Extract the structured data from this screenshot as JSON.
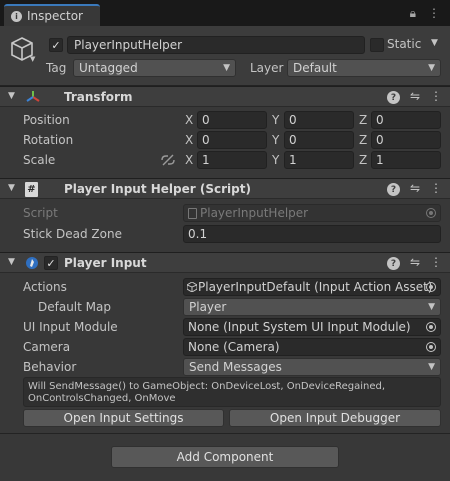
{
  "tab": {
    "title": "Inspector",
    "icon": "info-icon"
  },
  "header": {
    "name": "PlayerInputHelper",
    "static_label": "Static",
    "tag_label": "Tag",
    "tag_value": "Untagged",
    "layer_label": "Layer",
    "layer_value": "Default"
  },
  "transform": {
    "title": "Transform",
    "position_label": "Position",
    "rotation_label": "Rotation",
    "scale_label": "Scale",
    "axis_x": "X",
    "axis_y": "Y",
    "axis_z": "Z",
    "position": [
      "0",
      "0",
      "0"
    ],
    "rotation": [
      "0",
      "0",
      "0"
    ],
    "scale": [
      "1",
      "1",
      "1"
    ]
  },
  "helper": {
    "title": "Player Input Helper (Script)",
    "script_label": "Script",
    "script_value": "PlayerInputHelper",
    "deadzone_label": "Stick Dead Zone",
    "deadzone_value": "0.1"
  },
  "player_input": {
    "title": "Player Input",
    "actions_label": "Actions",
    "actions_value": "PlayerInputDefault (Input Action Asset)",
    "default_map_label": "Default Map",
    "default_map_value": "Player",
    "ui_module_label": "UI Input Module",
    "ui_module_value": "None (Input System UI Input Module)",
    "camera_label": "Camera",
    "camera_value": "None (Camera)",
    "behavior_label": "Behavior",
    "behavior_value": "Send Messages",
    "help_text": "Will SendMessage() to GameObject: OnDeviceLost, OnDeviceRegained, OnControlsChanged, OnMove",
    "settings_button": "Open Input Settings",
    "debugger_button": "Open Input Debugger"
  },
  "add_component": "Add Component",
  "colors": {
    "accent": "#3a79bb",
    "panel": "#383838",
    "field": "#2a2a2a"
  }
}
